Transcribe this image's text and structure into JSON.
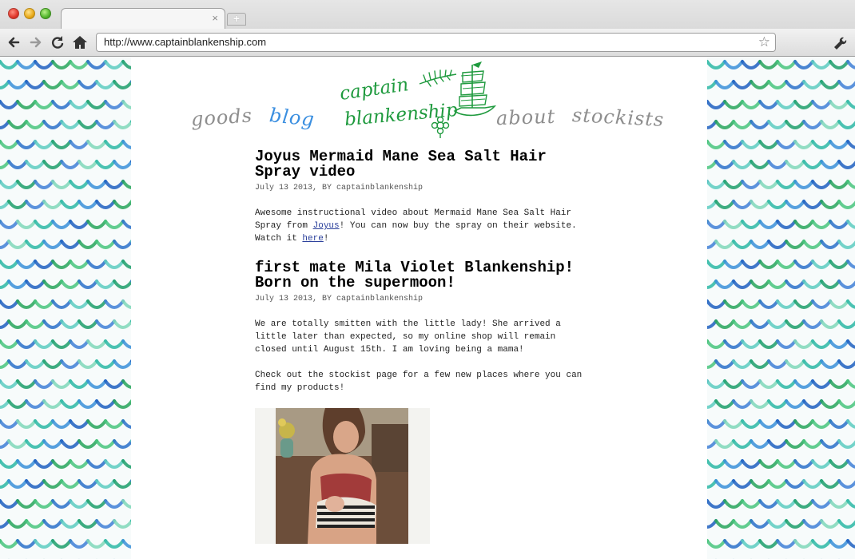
{
  "browser": {
    "url": "http://www.captainblankenship.com",
    "tab_close": "×",
    "new_tab": "+"
  },
  "icons": {
    "back": "arrow-left-icon",
    "forward": "arrow-right-icon",
    "reload": "reload-icon",
    "home": "home-icon",
    "star": "star-icon",
    "wrench": "wrench-icon"
  },
  "site": {
    "logo_line1": "captain",
    "logo_line2": "blankenship",
    "nav": {
      "goods": "goods",
      "blog": "blog",
      "about": "about",
      "stockists": "stockists"
    },
    "colors": {
      "logo_green": "#1f9a3e",
      "nav_active": "#3b8fe0",
      "nav_inactive": "#8e8e8e",
      "link": "#2a3f9b"
    }
  },
  "posts": [
    {
      "title": "Joyus Mermaid Mane Sea Salt Hair Spray video",
      "meta": "July 13 2013, BY captainblankenship",
      "body_1a": "Awesome instructional video about Mermaid Mane Sea Salt Hair Spray from ",
      "link_1": "Joyus",
      "body_1b": "! You can now buy the spray on their website.",
      "body_2a": "Watch it ",
      "link_2": "here",
      "body_2b": "!"
    },
    {
      "title": "first mate Mila Violet Blankenship! Born on the supermoon!",
      "meta": "July 13 2013, BY captainblankenship",
      "para_1": "We are totally smitten with the little lady! She arrived a little later than expected, so my online shop will remain closed until August 15th. I am loving being a mama!",
      "para_2": "Check out the stockist page for a few new places where you can find my products!"
    }
  ]
}
